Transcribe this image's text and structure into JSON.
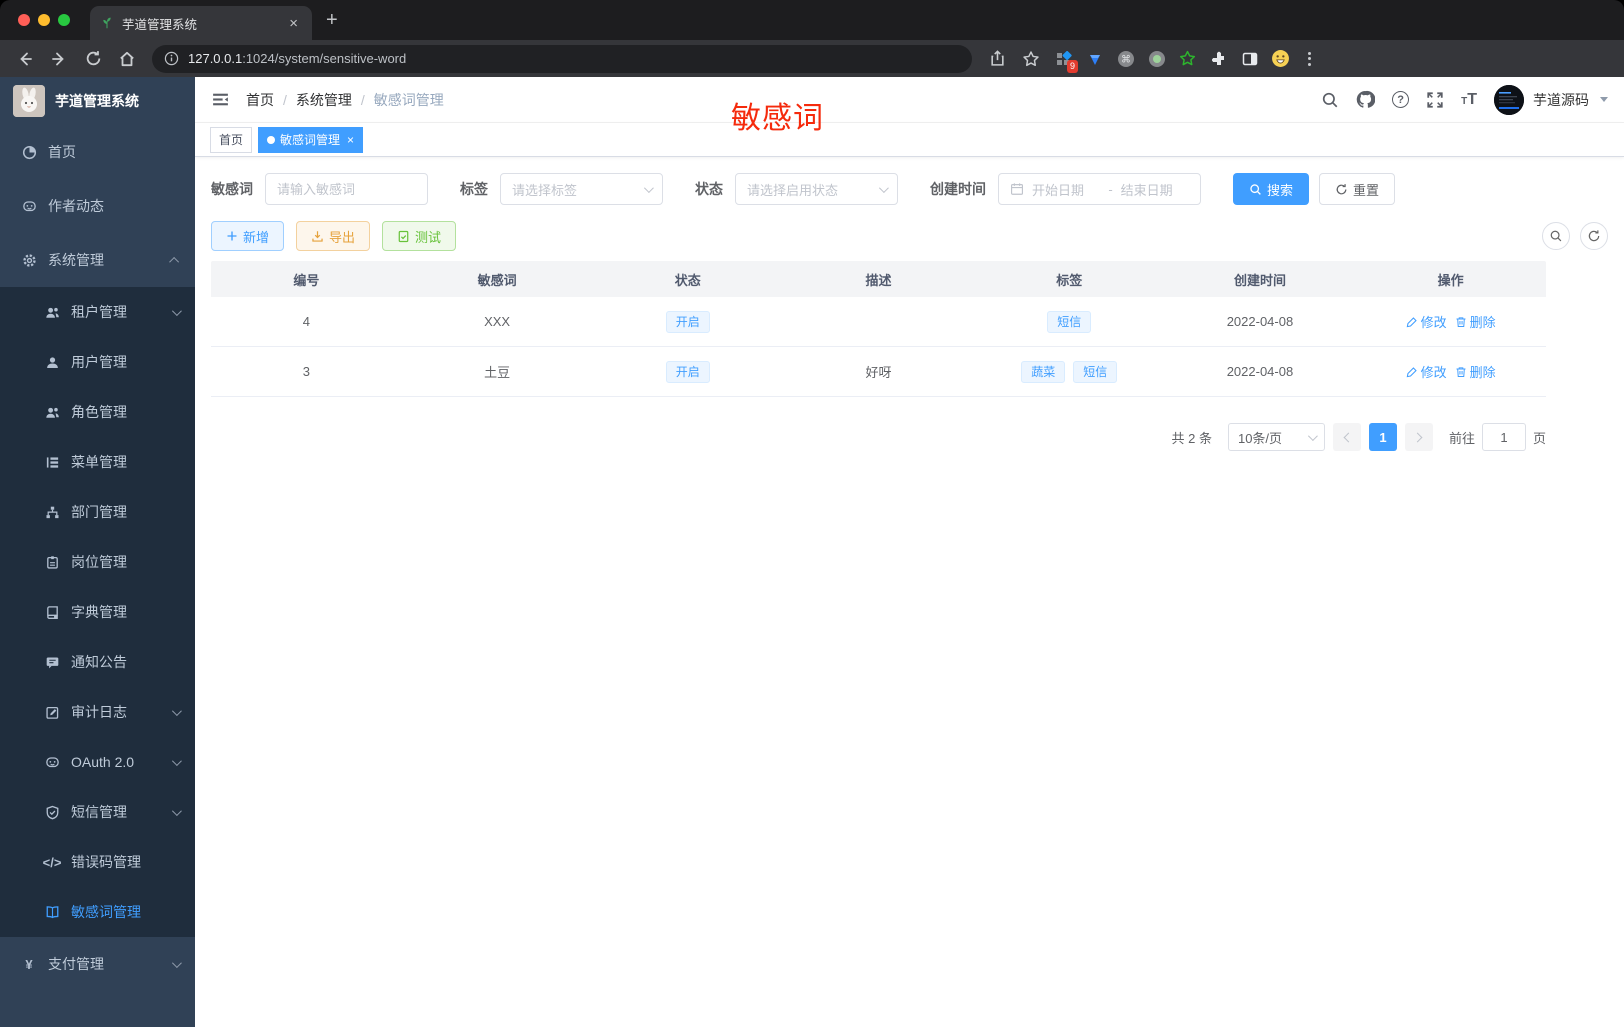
{
  "browser": {
    "tab_title": "芋道管理系统",
    "url_host": "127.0.0.1",
    "url_rest": ":1024/system/sensitive-word",
    "ext_badge": "9",
    "close_glyph": "×",
    "newtab_glyph": "+",
    "cmd_glyph": "⌘"
  },
  "sidebar": {
    "app_title": "芋道管理系统",
    "glyphs": {
      "code": "</>",
      "yen": "¥"
    },
    "items": [
      {
        "label": "首页"
      },
      {
        "label": "作者动态"
      },
      {
        "label": "系统管理"
      },
      {
        "label": "租户管理"
      },
      {
        "label": "用户管理"
      },
      {
        "label": "角色管理"
      },
      {
        "label": "菜单管理"
      },
      {
        "label": "部门管理"
      },
      {
        "label": "岗位管理"
      },
      {
        "label": "字典管理"
      },
      {
        "label": "通知公告"
      },
      {
        "label": "审计日志"
      },
      {
        "label": "OAuth 2.0"
      },
      {
        "label": "短信管理"
      },
      {
        "label": "错误码管理"
      },
      {
        "label": "敏感词管理"
      },
      {
        "label": "支付管理"
      }
    ]
  },
  "header": {
    "breadcrumb": [
      "首页",
      "系统管理",
      "敏感词管理"
    ],
    "separator": "/",
    "help_glyph": "?",
    "tsize_small": "T",
    "tsize_large": "T",
    "username": "芋道源码",
    "annotation": "敏感词"
  },
  "tags": {
    "home": "首页",
    "active": "敏感词管理",
    "close_glyph": "×"
  },
  "filters": {
    "keyword_label": "敏感词",
    "keyword_placeholder": "请输入敏感词",
    "tag_label": "标签",
    "tag_placeholder": "请选择标签",
    "status_label": "状态",
    "status_placeholder": "请选择启用状态",
    "date_label": "创建时间",
    "date_start": "开始日期",
    "date_sep": "-",
    "date_end": "结束日期",
    "search": "搜索",
    "reset": "重置"
  },
  "toolbar": {
    "add": "新增",
    "export": "导出",
    "test": "测试"
  },
  "table": {
    "headers": [
      "编号",
      "敏感词",
      "状态",
      "描述",
      "标签",
      "创建时间",
      "操作"
    ],
    "edit": "修改",
    "delete": "删除",
    "rows": [
      {
        "id": "4",
        "word": "XXX",
        "status": "开启",
        "desc": "",
        "tags": [
          "短信"
        ],
        "created": "2022-04-08"
      },
      {
        "id": "3",
        "word": "土豆",
        "status": "开启",
        "desc": "好呀",
        "tags": [
          "蔬菜",
          "短信"
        ],
        "created": "2022-04-08"
      }
    ]
  },
  "pagination": {
    "total": "共 2 条",
    "page_size": "10条/页",
    "page": "1",
    "goto_label": "前往",
    "goto_value": "1",
    "unit": "页"
  }
}
